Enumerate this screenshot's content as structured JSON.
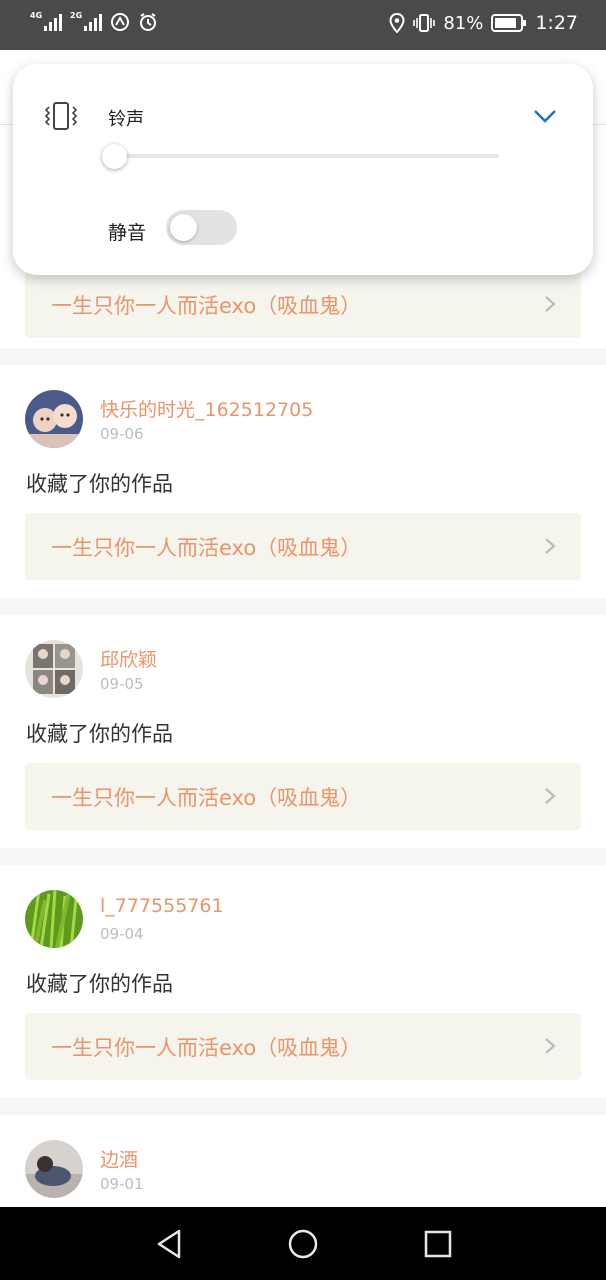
{
  "status_bar": {
    "sim1": "4G",
    "sim2": "2G",
    "battery": "81%",
    "time": "1:27"
  },
  "volume_panel": {
    "ringtone_label": "铃声",
    "mute_label": "静音",
    "ringtone_level": 0,
    "mute_on": false,
    "accent_color": "#1a73c8"
  },
  "feed": {
    "items": [
      {
        "work": "一生只你一人而活exo（吸血鬼）"
      },
      {
        "user": "快乐的时光_162512705",
        "date": "09-06",
        "action": "收藏了你的作品",
        "work": "一生只你一人而活exo（吸血鬼）"
      },
      {
        "user": "邱欣颖",
        "date": "09-05",
        "action": "收藏了你的作品",
        "work": "一生只你一人而活exo（吸血鬼）"
      },
      {
        "user": "l_777555761",
        "date": "09-04",
        "action": "收藏了你的作品",
        "work": "一生只你一人而活exo（吸血鬼）"
      },
      {
        "user": "边酒",
        "date": "09-01"
      }
    ],
    "name_color": "#e8956a"
  },
  "icons": {
    "status": [
      "signal-icon",
      "clock-alarm-icon",
      "location-icon",
      "vibrate-icon",
      "battery-icon"
    ],
    "nav": [
      "back-icon",
      "home-icon",
      "recents-icon"
    ]
  }
}
